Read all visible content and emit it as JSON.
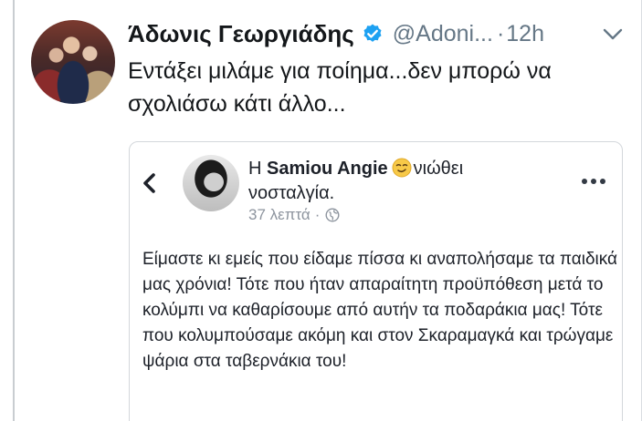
{
  "tweet": {
    "author_name": "Άδωνις Γεωργιάδης",
    "handle": "@Adoni...",
    "separator": "·",
    "time": "12h",
    "text": "Εντάξει μιλάμε για ποίημα...δεν μπορώ να σχολιάσω κάτι άλλο..."
  },
  "embedded_post": {
    "prefix": "Η",
    "author": "Samiou Angie",
    "feeling": "νιώθει νοσταλγία.",
    "time": "37 λεπτά",
    "separator": "·",
    "body": "Είμαστε κι εμείς που είδαμε πίσσα κι αναπολήσαμε τα παιδικά μας χρόνια! Τότε που ήταν απαραίτητη προϋπόθεση μετά το κολύμπι  να καθαρίσουμε από αυτήν τα ποδαράκια μας! Τότε που κολυμπούσαμε ακόμη και στον Σκαραμαγκά και τρώγαμε ψάρια στα ταβερνάκια του!"
  },
  "icons": {
    "verified": "verified-badge-icon",
    "chevron": "chevron-down-icon",
    "back": "chevron-left-icon",
    "emoji": "nostalgic-face-icon",
    "globe": "globe-icon",
    "more": "more-dots-icon"
  },
  "colors": {
    "verified_blue": "#1da1f2",
    "secondary_text": "#657786",
    "card_border": "#d3d7db"
  }
}
